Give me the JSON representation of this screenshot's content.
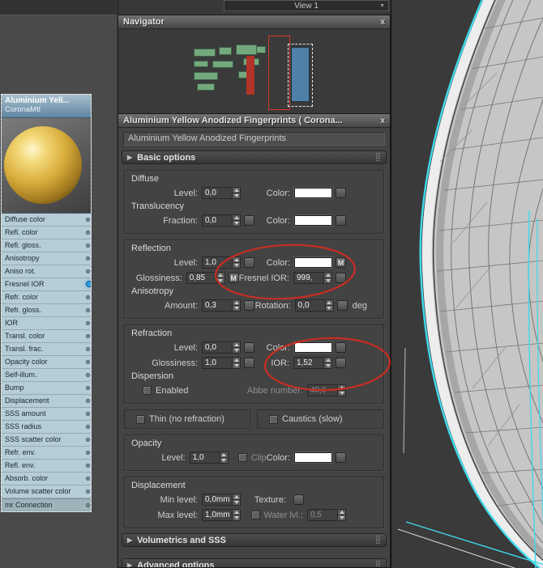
{
  "view_bar": {
    "label": "View 1"
  },
  "icons": {
    "chevron_down": "▼",
    "close": "x",
    "rollout_arrow": "▶",
    "grip": "⣿"
  },
  "navigator": {
    "title": "Navigator"
  },
  "node": {
    "title_line1": "Aluminium  Yell...",
    "title_line2": "CoronaMtl",
    "slots": [
      "Diffuse color",
      "Refl. color",
      "Refl. gloss.",
      "Anisotropy",
      "Aniso rot.",
      "Fresnel IOR",
      "Refr. color",
      "Refr. gloss.",
      "IOR",
      "Transl. color",
      "Transl. frac.",
      "Opacity color",
      "Self-illum.",
      "Bump",
      "Displacement",
      "SSS amount",
      "SSS radius",
      "SSS scatter color",
      "Refr. env.",
      "Refl. env.",
      "Absorb. color",
      "Volume scatter color"
    ],
    "active_slot": "Fresnel IOR",
    "footer_slot": "mr Connection"
  },
  "panel": {
    "title": "Aluminium Yellow Anodized Fingerprints  ( Corona...",
    "name_value": "Aluminium Yellow Anodized Fingerprints",
    "rollouts": {
      "basic": "Basic options",
      "volumetrics": "Volumetrics and SSS",
      "advanced": "Advanced options"
    },
    "headings": {
      "diffuse": "Diffuse",
      "translucency": "Translucency",
      "reflection": "Reflection",
      "anisotropy": "Anisotropy",
      "refraction": "Refraction",
      "dispersion": "Dispersion",
      "opacity": "Opacity",
      "displacement": "Displacement"
    },
    "labels": {
      "level": "Level:",
      "color": "Color:",
      "fraction": "Fraction:",
      "glossiness": "Glossiness:",
      "fresnel_ior": "Fresnel IOR:",
      "amount": "Amount:",
      "rotation": "Rotation:",
      "deg": "deg",
      "ior": "IOR:",
      "enabled": "Enabled",
      "abbe": "Abbe number:",
      "thin": "Thin (no refraction)",
      "caustics": "Caustics (slow)",
      "clip": "Clip",
      "min_level": "Min level:",
      "max_level": "Max level:",
      "texture": "Texture:",
      "water": "Water lvl.:",
      "map_assigned": "M"
    },
    "values": {
      "diffuse_level": "0,0",
      "translucency_fraction": "0,0",
      "reflection_level": "1,0",
      "reflection_glossiness": "0,85",
      "fresnel_ior": "999,",
      "aniso_amount": "0,3",
      "aniso_rotation": "0,0",
      "refraction_level": "0,0",
      "refraction_glossiness": "1,0",
      "refraction_ior": "1,52",
      "abbe_number": "40,0",
      "opacity_level": "1,0",
      "displacement_min": "0,0mm",
      "displacement_max": "1,0mm",
      "water_level": "0,5"
    }
  },
  "colors": {
    "annotation_red": "#c92d21",
    "selection_cyan": "#3fd9ec",
    "node_green": "#74a97e",
    "node_red": "#b23327",
    "nav_view_red": "#d23b2b",
    "node_blue": "#4e80a8",
    "swatch_white": "#ffffff",
    "material_gold": "#d9ad3c"
  }
}
